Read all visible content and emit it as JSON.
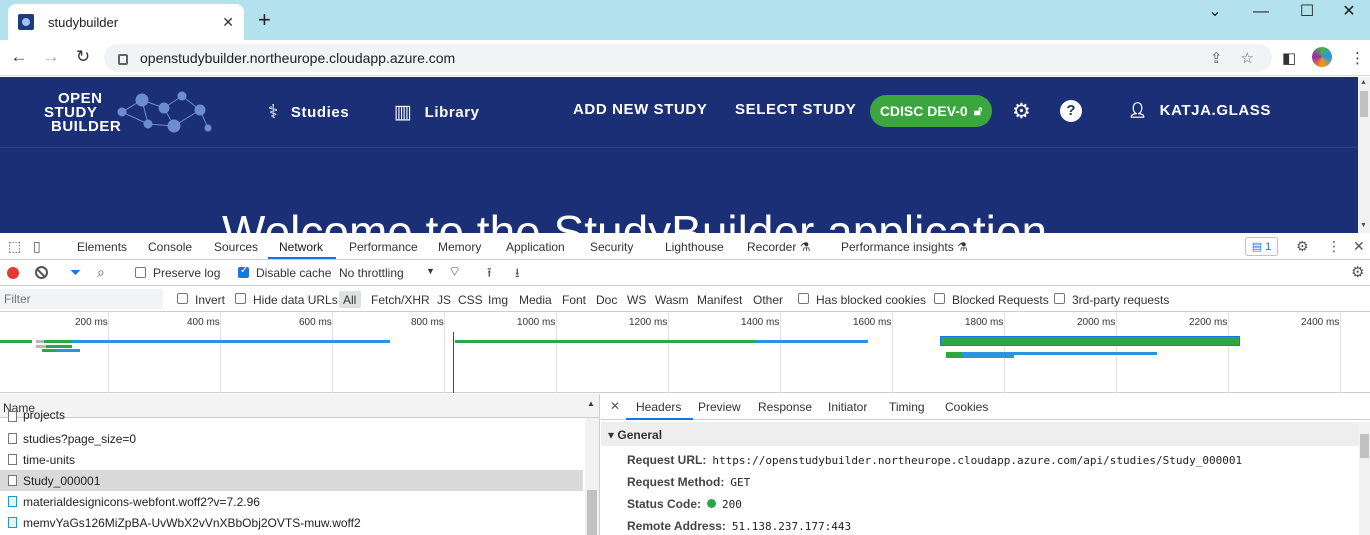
{
  "browser": {
    "tab_title": "studybuilder",
    "url": "openstudybuilder.northeurope.cloudapp.azure.com"
  },
  "app": {
    "logo": {
      "line1": "OPEN",
      "line2": "STUDY",
      "line3": "BUILDER"
    },
    "nav": {
      "studies": "Studies",
      "library": "Library",
      "add_new_study": "ADD NEW STUDY",
      "select_study": "SELECT STUDY",
      "environment": "CDISC DEV-0",
      "user": "KATJA.GLASS"
    },
    "hero_text": "Welcome to the StudyBuilder application"
  },
  "devtools": {
    "tabs": [
      "Elements",
      "Console",
      "Sources",
      "Network",
      "Performance",
      "Memory",
      "Application",
      "Security",
      "Lighthouse",
      "Recorder",
      "Performance insights"
    ],
    "active_tab": "Network",
    "issues_count": "1",
    "toolbar": {
      "preserve_log": "Preserve log",
      "disable_cache": "Disable cache",
      "throttling": "No throttling"
    },
    "filter_bar": {
      "placeholder": "Filter",
      "invert": "Invert",
      "hide_data_urls": "Hide data URLs",
      "types": [
        "All",
        "Fetch/XHR",
        "JS",
        "CSS",
        "Img",
        "Media",
        "Font",
        "Doc",
        "WS",
        "Wasm",
        "Manifest",
        "Other"
      ],
      "has_blocked_cookies": "Has blocked cookies",
      "blocked_requests": "Blocked Requests",
      "third_party": "3rd-party requests"
    },
    "timeline_ticks": [
      "200 ms",
      "400 ms",
      "600 ms",
      "800 ms",
      "1000 ms",
      "1200 ms",
      "1400 ms",
      "1600 ms",
      "1800 ms",
      "2000 ms",
      "2200 ms",
      "2400 ms"
    ],
    "requests": {
      "column_name": "Name",
      "rows": [
        {
          "name": "projects",
          "type": "doc"
        },
        {
          "name": "studies?page_size=0",
          "type": "doc"
        },
        {
          "name": "time-units",
          "type": "doc"
        },
        {
          "name": "Study_000001",
          "type": "doc",
          "selected": true
        },
        {
          "name": "materialdesignicons-webfont.woff2?v=7.2.96",
          "type": "font"
        },
        {
          "name": "memvYaGs126MiZpBA-UvWbX2vVnXBbObj2OVTS-muw.woff2",
          "type": "font"
        }
      ]
    },
    "detail": {
      "tabs": [
        "Headers",
        "Preview",
        "Response",
        "Initiator",
        "Timing",
        "Cookies"
      ],
      "active_tab": "Headers",
      "section": "General",
      "fields": [
        {
          "key": "Request URL:",
          "value": "https://openstudybuilder.northeurope.cloudapp.azure.com/api/studies/Study_000001"
        },
        {
          "key": "Request Method:",
          "value": "GET"
        },
        {
          "key": "Status Code:",
          "value": "200"
        },
        {
          "key": "Remote Address:",
          "value": "51.138.237.177:443"
        }
      ]
    }
  },
  "colors": {
    "app_header": "#1a2f76",
    "env_badge": "#3aa63d",
    "tabstrip": "#b3e2ee",
    "devtools_accent": "#1a73e8"
  }
}
